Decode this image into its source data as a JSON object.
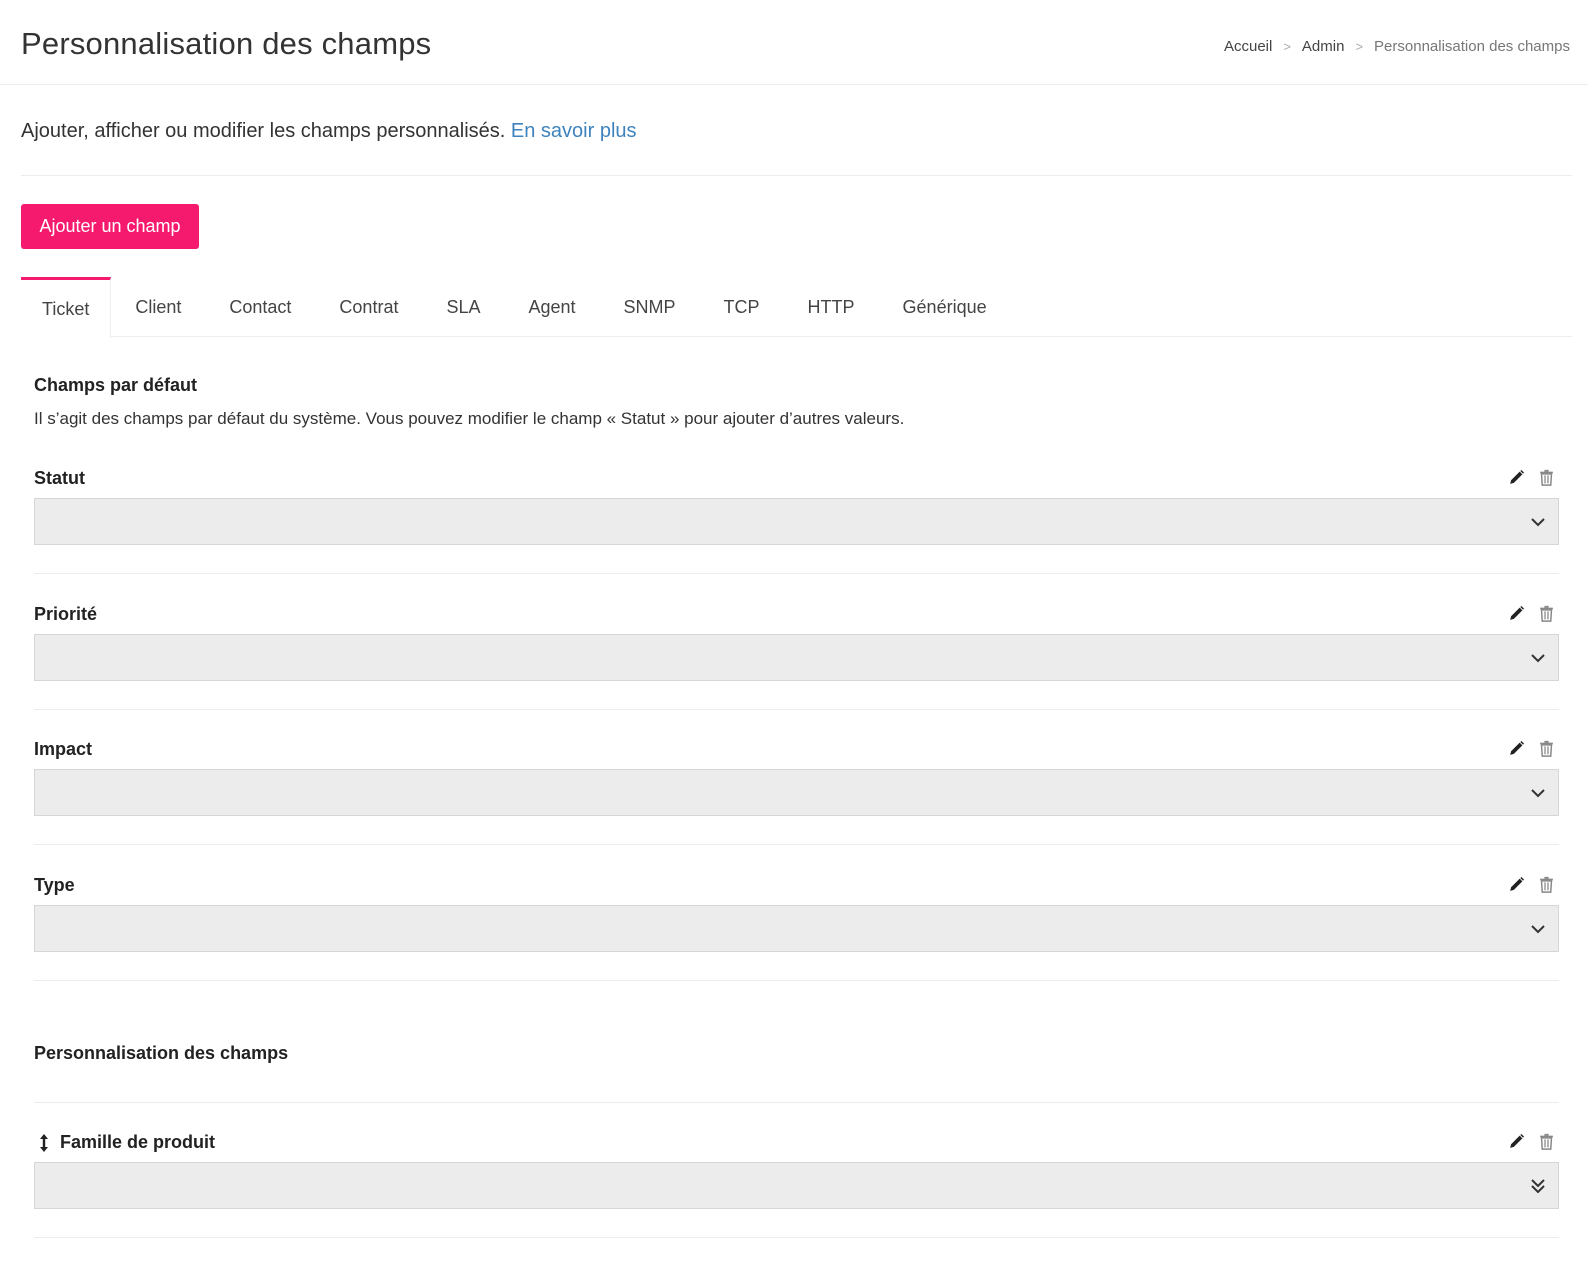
{
  "header": {
    "title": "Personnalisation des champs",
    "breadcrumb": [
      "Accueil",
      "Admin",
      "Personnalisation des champs"
    ],
    "breadcrumb_separator": ">"
  },
  "intro": {
    "text": "Ajouter, afficher ou modifier les champs personnalisés.",
    "link": "En savoir plus"
  },
  "add_button": {
    "label": "Ajouter un champ"
  },
  "tabs": [
    {
      "label": "Ticket",
      "active": true
    },
    {
      "label": "Client"
    },
    {
      "label": "Contact"
    },
    {
      "label": "Contrat"
    },
    {
      "label": "SLA"
    },
    {
      "label": "Agent"
    },
    {
      "label": "SNMP"
    },
    {
      "label": "TCP"
    },
    {
      "label": "HTTP"
    },
    {
      "label": "Générique"
    }
  ],
  "default_fields": {
    "title": "Champs par défaut",
    "description": "Il s’agit des champs par défaut du système. Vous pouvez modifier le champ « Statut » pour ajouter d’autres valeurs.",
    "fields": [
      {
        "label": "Statut",
        "value": ""
      },
      {
        "label": "Priorité",
        "value": ""
      },
      {
        "label": "Impact",
        "value": ""
      },
      {
        "label": "Type",
        "value": ""
      }
    ]
  },
  "custom_fields": {
    "title": "Personnalisation des champs",
    "fields": [
      {
        "label": "Famille de produit",
        "value": ""
      }
    ]
  },
  "colors": {
    "accent": "#f51a6e",
    "link": "#3f83bd",
    "select_bg": "#ececec"
  },
  "icons": {
    "edit": "pencil-icon",
    "delete": "trash-icon",
    "dropdown": "chevron-down-icon",
    "multi_dropdown": "double-chevron-down-icon",
    "drag": "drag-handle-icon"
  }
}
